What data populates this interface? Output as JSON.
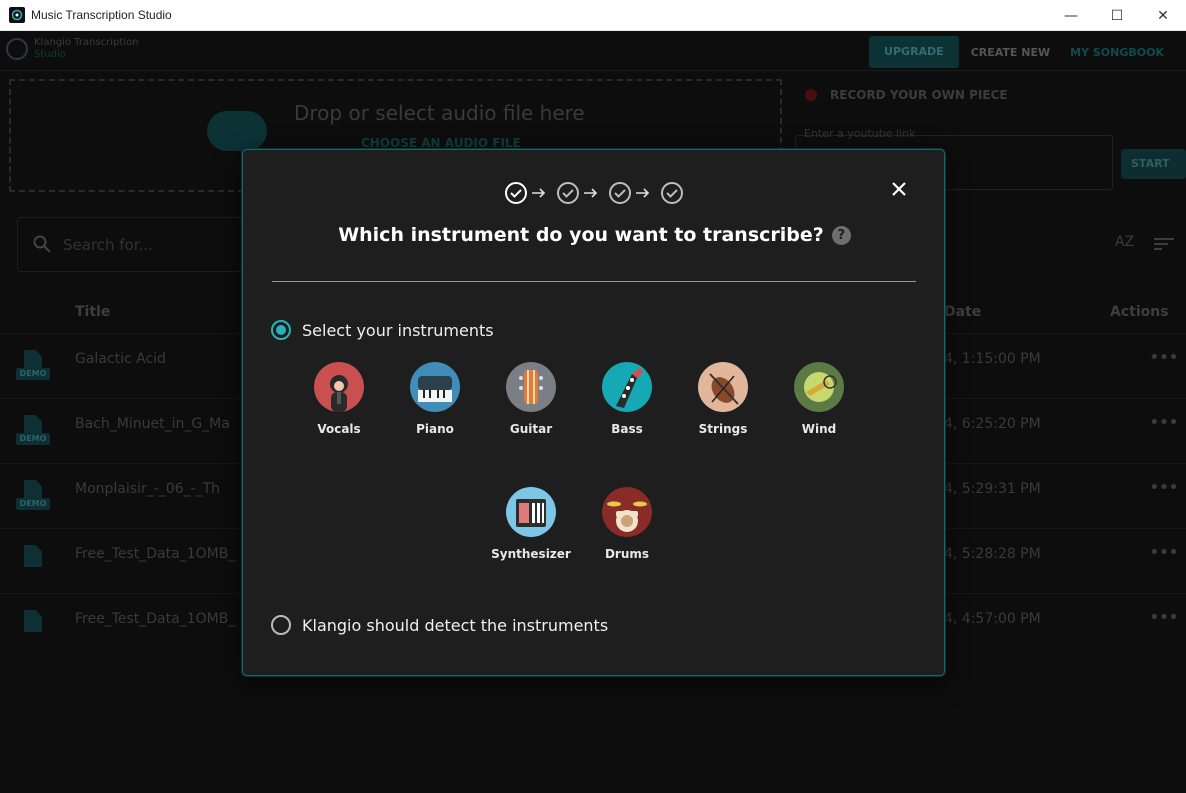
{
  "window": {
    "title": "Music Transcription Studio",
    "controls": [
      "—",
      "☐",
      "✕"
    ]
  },
  "app": {
    "brand_name": "Klangio Transcription",
    "brand_sub": "Studio",
    "nav": {
      "upgrade": "UPGRADE",
      "create_new": "CREATE NEW",
      "songbook": "MY SONGBOOK"
    },
    "dropzone": {
      "text": "Drop or select audio file here",
      "choose": "CHOOSE AN AUDIO FILE"
    },
    "record_label": "RECORD YOUR OWN PIECE",
    "youtube_label": "Enter a youtube link",
    "start_button": "START",
    "search_placeholder": "Search for...",
    "sort_az": "AZ",
    "table": {
      "col_title": "Title",
      "col_date": "Date",
      "col_actions": "Actions",
      "rows": [
        {
          "title": "Galactic Acid",
          "date": "4, 1:15:00 PM",
          "demo": "DEMO"
        },
        {
          "title": "Bach_Minuet_in_G_Ma",
          "date": "4, 6:25:20 PM",
          "demo": "DEMO"
        },
        {
          "title": "Monplaisir_-_06_-_Th",
          "date": "4, 5:29:31 PM",
          "demo": "DEMO"
        },
        {
          "title": "Free_Test_Data_1OMB_",
          "date": "4, 5:28:28 PM",
          "demo": ""
        },
        {
          "title": "Free_Test_Data_1OMB_",
          "date": "4, 4:57:00 PM",
          "demo": ""
        }
      ],
      "more": "•••"
    }
  },
  "modal": {
    "title": "Which instrument do you want to transcribe?",
    "help": "?",
    "option_select": "Select your instruments",
    "option_detect": "Klangio should detect the instruments",
    "selected_option": "select",
    "instruments": [
      {
        "name": "Vocals",
        "icon": "vocals-icon",
        "color": "#c9504f"
      },
      {
        "name": "Piano",
        "icon": "piano-icon",
        "color": "#3f8db8"
      },
      {
        "name": "Guitar",
        "icon": "guitar-icon",
        "color": "#7a7f85"
      },
      {
        "name": "Bass",
        "icon": "bass-icon",
        "color": "#16a9b5"
      },
      {
        "name": "Strings",
        "icon": "strings-icon",
        "color": "#e2b69a"
      },
      {
        "name": "Wind",
        "icon": "wind-icon",
        "color": "#5b7a45"
      },
      {
        "name": "Synthesizer",
        "icon": "synthesizer-icon",
        "color": "#7cc7e6"
      },
      {
        "name": "Drums",
        "icon": "drums-icon",
        "color": "#8a2b28"
      }
    ]
  },
  "colors": {
    "accent": "#27b3b8",
    "modal_border": "#15676b",
    "modal_bg": "#1e1e1e"
  }
}
